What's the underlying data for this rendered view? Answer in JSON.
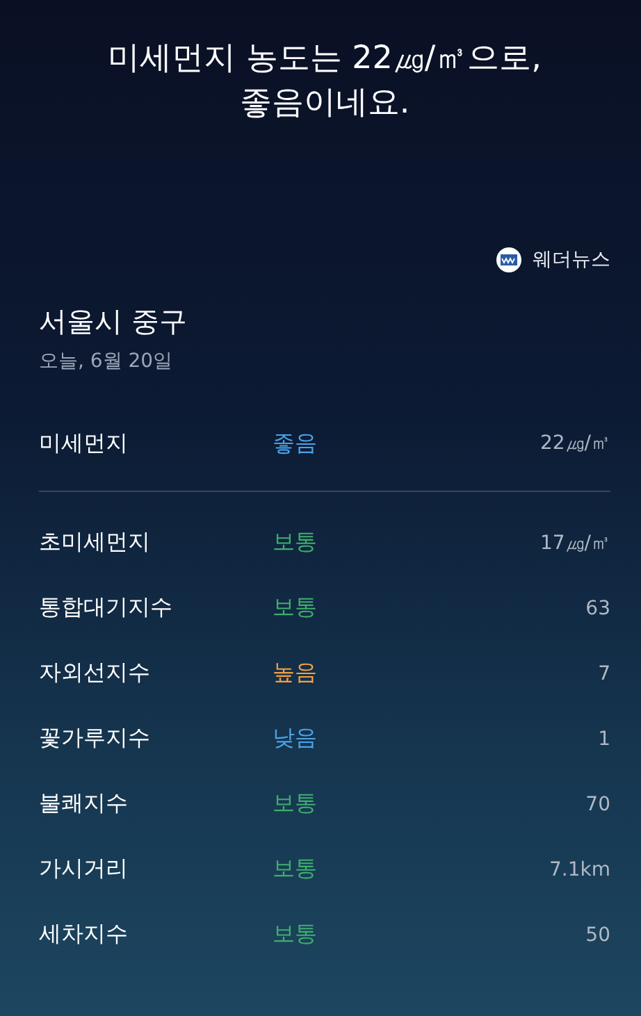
{
  "headline": "미세먼지 농도는 22㎍/㎥으로, 좋음이네요.",
  "source": {
    "name": "웨더뉴스"
  },
  "location": {
    "title": "서울시 중구",
    "date": "오늘, 6월 20일"
  },
  "main": {
    "name": "미세먼지",
    "status": "좋음",
    "color": "#4aa3e8",
    "value": "22㎍/㎥"
  },
  "rows": [
    {
      "name": "초미세먼지",
      "status": "보통",
      "color": "#3fae6e",
      "value": "17㎍/㎥"
    },
    {
      "name": "통합대기지수",
      "status": "보통",
      "color": "#3fae6e",
      "value": "63"
    },
    {
      "name": "자외선지수",
      "status": "높음",
      "color": "#f0a044",
      "value": "7"
    },
    {
      "name": "꽃가루지수",
      "status": "낮음",
      "color": "#4aa3e8",
      "value": "1"
    },
    {
      "name": "불쾌지수",
      "status": "보통",
      "color": "#3fae6e",
      "value": "70"
    },
    {
      "name": "가시거리",
      "status": "보통",
      "color": "#3fae6e",
      "value": "7.1km"
    },
    {
      "name": "세차지수",
      "status": "보통",
      "color": "#3fae6e",
      "value": "50"
    }
  ]
}
